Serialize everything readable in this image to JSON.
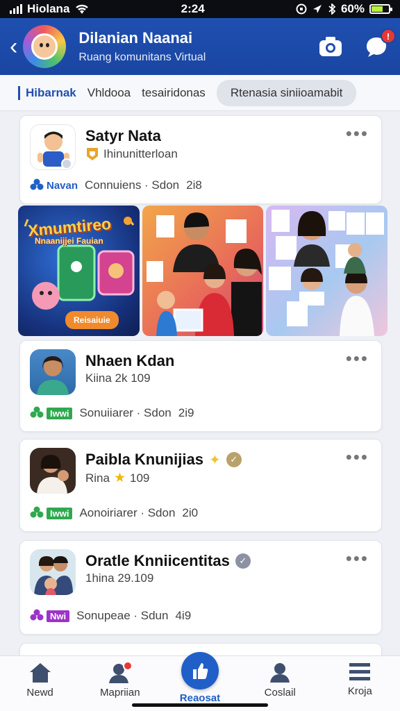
{
  "status_bar": {
    "carrier": "Hiolana",
    "time": "2:24",
    "battery": "60%",
    "battery_level": 0.6
  },
  "header": {
    "title": "Dilanian Naanai",
    "subtitle": "Ruang komunitans Virtual"
  },
  "tabs": [
    {
      "label": "Hibarnak",
      "active": true
    },
    {
      "label": "Vhldooa"
    },
    {
      "label": "tesairidonas"
    },
    {
      "label": "Rtenasia siniioamabit",
      "pill": true
    }
  ],
  "posts": [
    {
      "name": "Satyr Nata",
      "subtitle": "Ihinunitterloan",
      "tag": "Navan",
      "meta": "Connuiens · Sdon",
      "count": "2i8",
      "tag_color": "#1f5fc7"
    },
    {
      "name": "Nhaen Kdan",
      "subtitle": "Kiina 2k 109",
      "tag": "Iwwi",
      "meta": "Sonuiiarer · Sdon",
      "count": "2i9",
      "tag_color": "#2fa84f"
    },
    {
      "name": "Paibla Knunijias",
      "subtitle": "Rina",
      "subtitle_extra": "109",
      "tag": "Iwwi",
      "meta": "Aonoiriarer · Sdon",
      "count": "2i0",
      "tag_color": "#2fa84f"
    },
    {
      "name": "Oratle Knniicentitas",
      "subtitle": "1hina 29.109",
      "tag": "Nwi",
      "meta": "Sonupeae · Sdun",
      "count": "4i9",
      "tag_color": "#9c33c9"
    }
  ],
  "gallery": {
    "promo_title": "Xmumtireo",
    "promo_subtitle": "Nnaanijjei Fauian",
    "promo_button": "Reisaiuie"
  },
  "bottom_nav": [
    {
      "label": "Newd",
      "icon": "home-icon"
    },
    {
      "label": "Mapriian",
      "icon": "person-icon"
    },
    {
      "label": "Reaosat",
      "icon": "thumbs-up-icon"
    },
    {
      "label": "Coslail",
      "icon": "user-icon"
    },
    {
      "label": "Kroja",
      "icon": "menu-icon"
    }
  ],
  "colors": {
    "header": "#1f4fb0",
    "accent": "#1f5fc7",
    "badge_red": "#e53935"
  }
}
